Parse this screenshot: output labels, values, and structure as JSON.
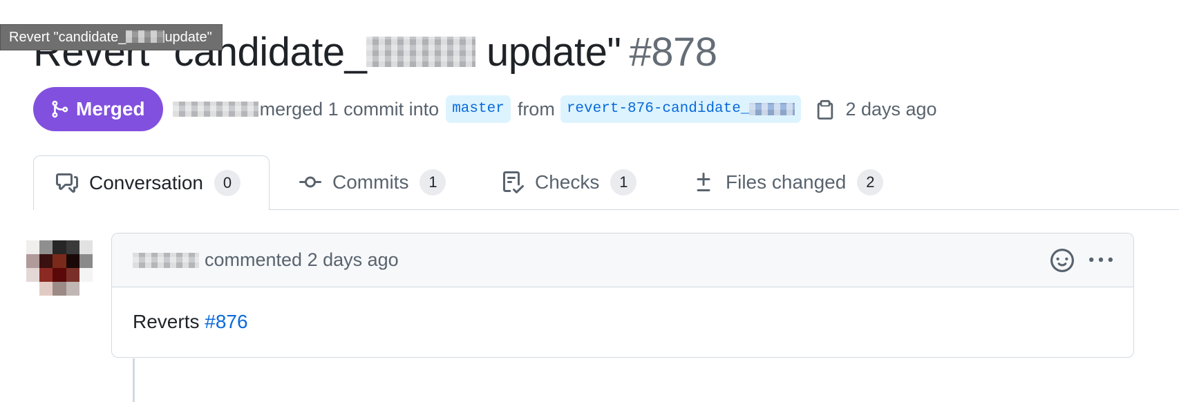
{
  "tooltip": {
    "before": "Revert \"candidate_",
    "after": "update\""
  },
  "title": {
    "before": "Revert \"candidate_",
    "after": "update\"",
    "number": "#878"
  },
  "status": {
    "state_label": "Merged",
    "merged_text": "merged 1 commit into",
    "base_branch": "master",
    "from_text": "from",
    "head_branch_prefix": "revert-876-candidate_",
    "time": "2 days ago"
  },
  "tabs": [
    {
      "label": "Conversation",
      "count": "0",
      "icon": "comment-discussion-icon"
    },
    {
      "label": "Commits",
      "count": "1",
      "icon": "git-commit-icon"
    },
    {
      "label": "Checks",
      "count": "1",
      "icon": "checklist-icon"
    },
    {
      "label": "Files changed",
      "count": "2",
      "icon": "diff-icon"
    }
  ],
  "comment": {
    "action": "commented 2 days ago",
    "body_text": "Reverts",
    "body_link": "#876"
  },
  "colors": {
    "merged": "#8250df",
    "link": "#0969da",
    "branch_bg": "#ddf4ff",
    "muted": "#59636e"
  }
}
